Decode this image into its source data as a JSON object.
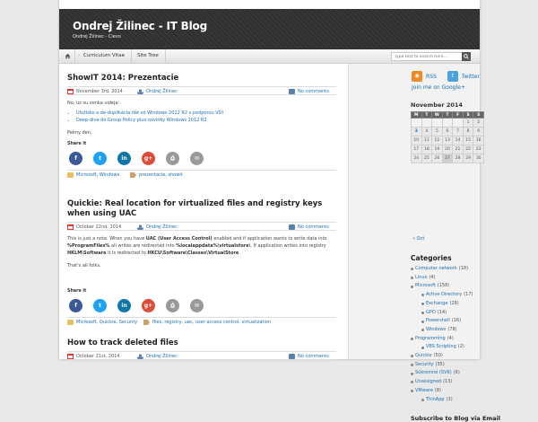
{
  "header": {
    "title": "Ondrej Žilinec - IT Blog",
    "tagline": "Ondrej Žilinec - Cievo"
  },
  "nav": {
    "items": [
      "Curriculum Vitae",
      "Site Tree"
    ],
    "search_placeholder": "Type text to search here..."
  },
  "posts": [
    {
      "title": "ShowIT 2014: Prezentacie",
      "date": "November 3rd, 2014",
      "author": "Ondrej Žilinec",
      "comments": "No comments",
      "intro": "No, uz su vonka videja:",
      "links": [
        "Uložisko a de-duplikácia dát vo Windows 2012 R2 s podporou VDI",
        "Deep-dive do Group Policy plus novinky Windows 2012 R2"
      ],
      "outro": "Pekny den,",
      "share_label": "Share it",
      "categories": "Microsoft, Windows",
      "tags": "prezentacie, showit"
    },
    {
      "title": "Quickie: Real location for virtualized files and registry keys when using UAC",
      "date": "October 22nd, 2014",
      "author": "Ondrej Žilinec",
      "comments": "No comments",
      "body": [
        {
          "t": "This is just a note. When you have "
        },
        {
          "b": "UAC (User Access Control)"
        },
        {
          "t": " enabled and if application wants to write data into "
        },
        {
          "b": "%ProgramFiles%"
        },
        {
          "t": " all writes are redirected into "
        },
        {
          "b": "%localappdata%\\virtualstore\\"
        },
        {
          "t": ". If application writes into registry "
        },
        {
          "b": "HKLM\\Software"
        },
        {
          "t": " it is redirected to "
        },
        {
          "b": "HKCU\\Software\\Classes\\VirtualStore"
        },
        {
          "t": "."
        }
      ],
      "outro": "That's all folks,",
      "share_label": "Share it",
      "categories": "Microsoft, Quickie, Security",
      "tags": "files, registry, uac, user access control, virtualization"
    },
    {
      "title": "How to track deleted files",
      "date": "October 21st, 2014",
      "author": "Ondrej Žilinec",
      "comments": "No comments"
    }
  ],
  "share_buttons": [
    {
      "icon": "facebook-icon",
      "glyph": "f",
      "color": "#3b5998"
    },
    {
      "icon": "twitter-icon",
      "glyph": "t",
      "color": "#1da1f2"
    },
    {
      "icon": "linkedin-icon",
      "glyph": "in",
      "color": "#0e76a8"
    },
    {
      "icon": "google-plus-icon",
      "glyph": "g+",
      "color": "#dd4b39"
    },
    {
      "icon": "print-icon",
      "glyph": "⎙",
      "color": "#999999"
    },
    {
      "icon": "email-icon",
      "glyph": "✉",
      "color": "#999999"
    }
  ],
  "sidebar": {
    "rss_label": "RSS",
    "twitter_label": "Twitter",
    "google_label": "Join me on Google+",
    "calendar": {
      "title": "November 2014",
      "weekdays": [
        "M",
        "T",
        "W",
        "T",
        "F",
        "S",
        "S"
      ],
      "weeks": [
        [
          "",
          "",
          "",
          "",
          "",
          "1",
          "2"
        ],
        [
          "3",
          "4",
          "5",
          "6",
          "7",
          "8",
          "9"
        ],
        [
          "10",
          "11",
          "12",
          "13",
          "14",
          "15",
          "16"
        ],
        [
          "17",
          "18",
          "19",
          "20",
          "21",
          "22",
          "23"
        ],
        [
          "24",
          "25",
          "26",
          "27",
          "28",
          "29",
          "30"
        ]
      ],
      "today": "27",
      "linked": "3",
      "prev": "« Oct"
    },
    "categories_title": "Categories",
    "categories": [
      {
        "name": "Computer network",
        "count": "(18)",
        "level": 0
      },
      {
        "name": "Linux",
        "count": "(4)",
        "level": 0
      },
      {
        "name": "Microsoft",
        "count": "(158)",
        "level": 0
      },
      {
        "name": "Active Directory",
        "count": "(17)",
        "level": 1
      },
      {
        "name": "Exchange",
        "count": "(28)",
        "level": 1
      },
      {
        "name": "GPO",
        "count": "(14)",
        "level": 1
      },
      {
        "name": "Powershell",
        "count": "(16)",
        "level": 1
      },
      {
        "name": "Windows",
        "count": "(78)",
        "level": 1
      },
      {
        "name": "Programming",
        "count": "(4)",
        "level": 0
      },
      {
        "name": "VBS Scripting",
        "count": "(2)",
        "level": 1
      },
      {
        "name": "Quickie",
        "count": "(50)",
        "level": 0
      },
      {
        "name": "Security",
        "count": "(35)",
        "level": 0
      },
      {
        "name": "Súkromné (SVK)",
        "count": "(6)",
        "level": 0
      },
      {
        "name": "Unassigned",
        "count": "(13)",
        "level": 0
      },
      {
        "name": "VMware",
        "count": "(8)",
        "level": 0
      },
      {
        "name": "ThinApp",
        "count": "(3)",
        "level": 1
      }
    ],
    "subscribe_title": "Subscribe to Blog via Email"
  }
}
